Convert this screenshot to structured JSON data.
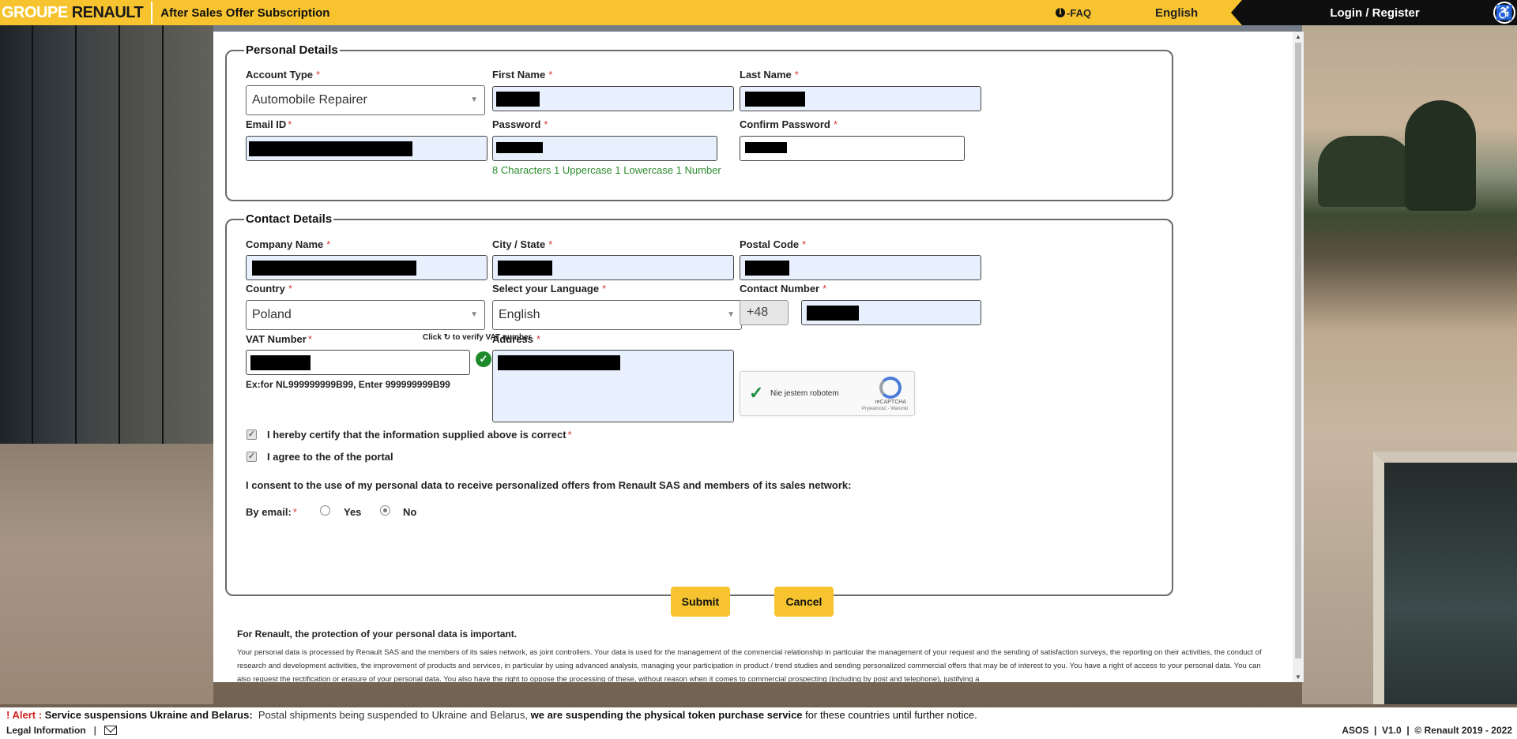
{
  "header": {
    "logo_groupe": "GROUPE",
    "logo_renault": "RENAULT",
    "title": "After Sales Offer Subscription",
    "faq": "FAQ",
    "language": "English",
    "login": "Login / Register"
  },
  "personal": {
    "legend": "Personal Details",
    "account_type_label": "Account Type",
    "account_type_value": "Automobile Repairer",
    "first_name_label": "First Name",
    "last_name_label": "Last Name",
    "email_label": "Email ID",
    "password_label": "Password",
    "confirm_password_label": "Confirm Password",
    "password_hint": "8 Characters  1 Uppercase  1 Lowercase  1 Number"
  },
  "contact": {
    "legend": "Contact Details",
    "company_label": "Company Name",
    "city_label": "City / State",
    "postal_label": "Postal Code",
    "country_label": "Country",
    "country_value": "Poland",
    "language_label": "Select your Language",
    "language_value": "English",
    "contact_label": "Contact Number",
    "phone_prefix": "+48",
    "vat_label": "VAT Number",
    "vat_verify_prefix": "Click",
    "vat_verify_suffix": "to verify VAT number",
    "vat_example": "Ex:for NL999999999B99, Enter 999999999B99",
    "address_label": "Address",
    "captcha_text": "Nie jestem robotem",
    "captcha_brand": "reCAPTCHA",
    "captcha_sub": "Prywatność - Warunki",
    "certify_text": "I hereby certify that the information supplied above is correct",
    "agree_text": "I agree to the of the portal",
    "consent_text": "I consent to the use of my personal data to receive personalized offers from Renault SAS and members of its sales network:",
    "by_email_label": "By email:",
    "yes_label": "Yes",
    "no_label": "No"
  },
  "actions": {
    "submit": "Submit",
    "cancel": "Cancel"
  },
  "privacy": {
    "title": "For Renault, the protection of your personal data is important.",
    "body": "Your personal data is processed by Renault SAS and the members of its sales network, as joint controllers. Your data is used for the management of the commercial relationship in particular the management of your request and the sending of satisfaction surveys, the reporting on their activities, the conduct of research and development activities, the improvement of products and services, in particular by using advanced analysis, managing your participation in product / trend studies and sending personalized commercial offers that may be of interest to you. You have a right of access to your personal data. You can also request the rectification or erasure of your personal data. You also have the right to oppose the processing of these, without reason when it comes to commercial prospecting (including by post and telephone), justifying a"
  },
  "footer": {
    "alert_label": "! Alert :",
    "alert_title": "Service suspensions Ukraine and Belarus:",
    "alert_text_1": "Postal shipments being suspended to Ukraine and Belarus,",
    "alert_bold": "we are suspending the physical token purchase service",
    "alert_text_2": "for these countries until further notice.",
    "legal": "Legal Information",
    "app_name": "ASOS",
    "version": "V1.0",
    "copyright": "© Renault 2019 - 2022"
  },
  "colors": {
    "brand_yellow": "#f7c42f",
    "dark": "#0f0f0f",
    "required": "#d43a2f",
    "hint_green": "#2e8b2e"
  }
}
